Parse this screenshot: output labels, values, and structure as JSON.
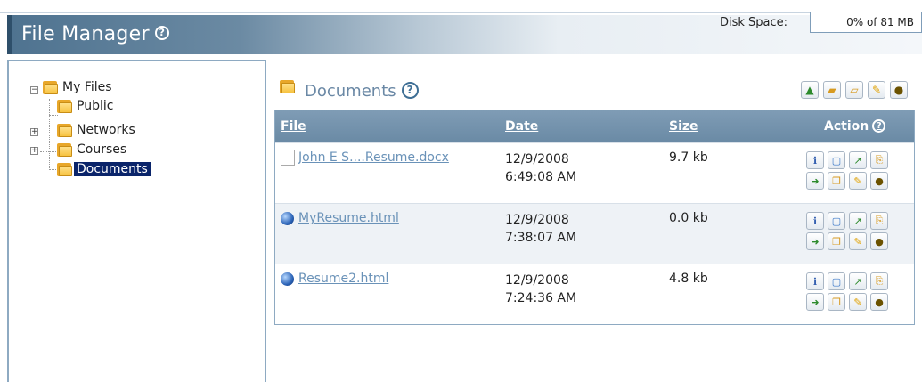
{
  "header": {
    "title": "File Manager",
    "disk_label": "Disk Space:",
    "disk_value": "0% of 81 MB"
  },
  "tree": {
    "root": "My Files",
    "items": [
      {
        "label": "Public"
      },
      {
        "label": "Networks"
      },
      {
        "label": "Courses"
      },
      {
        "label": "Documents"
      }
    ]
  },
  "main": {
    "title": "Documents",
    "columns": {
      "file": "File",
      "date": "Date",
      "size": "Size",
      "action": "Action"
    },
    "rows": [
      {
        "name": "John E S....Resume.docx",
        "date": "12/9/2008",
        "time": "6:49:08 AM",
        "size": "9.7 kb",
        "icon": "document-icon"
      },
      {
        "name": "MyResume.html",
        "date": "12/9/2008",
        "time": "7:38:07 AM",
        "size": "0.0 kb",
        "icon": "web-page-icon"
      },
      {
        "name": "Resume2.html",
        "date": "12/9/2008",
        "time": "7:24:36 AM",
        "size": "4.8 kb",
        "icon": "web-page-icon"
      }
    ]
  },
  "colors": {
    "header_dark": "#2e4f6a",
    "table_header": "#7f9cb5",
    "link": "#6a92b8",
    "selected": "#0a246a"
  },
  "icons": {
    "toolbar": [
      "upload-icon",
      "new-folder-icon",
      "open-folder-icon",
      "rename-icon",
      "delete-icon"
    ],
    "row_actions": [
      "info-icon",
      "comment-icon",
      "edit-icon",
      "copy-to-icon",
      "move-icon",
      "duplicate-icon",
      "rename-icon",
      "delete-icon"
    ]
  }
}
